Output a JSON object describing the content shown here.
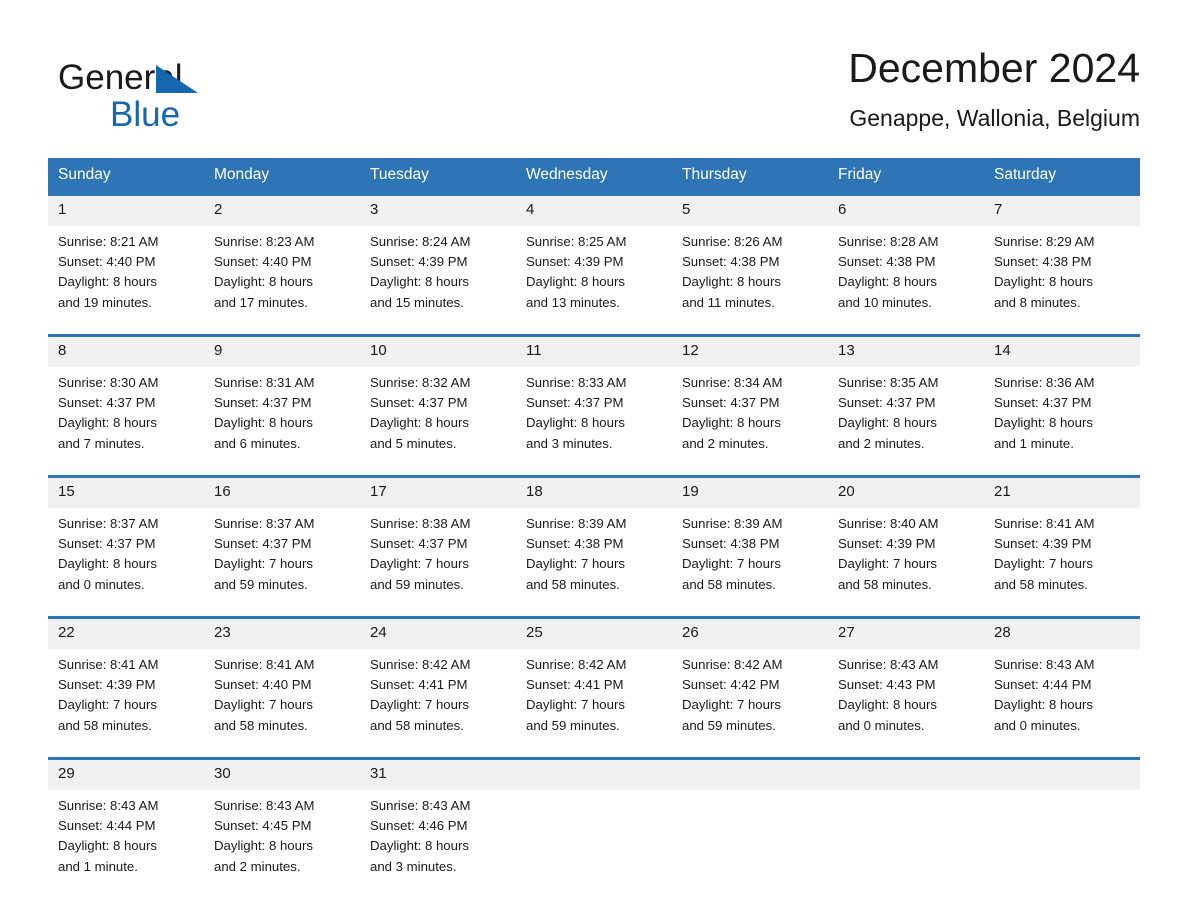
{
  "brand": {
    "name_top": "General",
    "name_bottom": "Blue",
    "accent_color": "#1666b0",
    "header_color": "#2e75b6"
  },
  "header": {
    "title": "December 2024",
    "subtitle": "Genappe, Wallonia, Belgium"
  },
  "weekday_headers": [
    "Sunday",
    "Monday",
    "Tuesday",
    "Wednesday",
    "Thursday",
    "Friday",
    "Saturday"
  ],
  "weeks": [
    [
      {
        "day": "1",
        "sunrise": "Sunrise: 8:21 AM",
        "sunset": "Sunset: 4:40 PM",
        "daylight_line1": "Daylight: 8 hours",
        "daylight_line2": "and 19 minutes."
      },
      {
        "day": "2",
        "sunrise": "Sunrise: 8:23 AM",
        "sunset": "Sunset: 4:40 PM",
        "daylight_line1": "Daylight: 8 hours",
        "daylight_line2": "and 17 minutes."
      },
      {
        "day": "3",
        "sunrise": "Sunrise: 8:24 AM",
        "sunset": "Sunset: 4:39 PM",
        "daylight_line1": "Daylight: 8 hours",
        "daylight_line2": "and 15 minutes."
      },
      {
        "day": "4",
        "sunrise": "Sunrise: 8:25 AM",
        "sunset": "Sunset: 4:39 PM",
        "daylight_line1": "Daylight: 8 hours",
        "daylight_line2": "and 13 minutes."
      },
      {
        "day": "5",
        "sunrise": "Sunrise: 8:26 AM",
        "sunset": "Sunset: 4:38 PM",
        "daylight_line1": "Daylight: 8 hours",
        "daylight_line2": "and 11 minutes."
      },
      {
        "day": "6",
        "sunrise": "Sunrise: 8:28 AM",
        "sunset": "Sunset: 4:38 PM",
        "daylight_line1": "Daylight: 8 hours",
        "daylight_line2": "and 10 minutes."
      },
      {
        "day": "7",
        "sunrise": "Sunrise: 8:29 AM",
        "sunset": "Sunset: 4:38 PM",
        "daylight_line1": "Daylight: 8 hours",
        "daylight_line2": "and 8 minutes."
      }
    ],
    [
      {
        "day": "8",
        "sunrise": "Sunrise: 8:30 AM",
        "sunset": "Sunset: 4:37 PM",
        "daylight_line1": "Daylight: 8 hours",
        "daylight_line2": "and 7 minutes."
      },
      {
        "day": "9",
        "sunrise": "Sunrise: 8:31 AM",
        "sunset": "Sunset: 4:37 PM",
        "daylight_line1": "Daylight: 8 hours",
        "daylight_line2": "and 6 minutes."
      },
      {
        "day": "10",
        "sunrise": "Sunrise: 8:32 AM",
        "sunset": "Sunset: 4:37 PM",
        "daylight_line1": "Daylight: 8 hours",
        "daylight_line2": "and 5 minutes."
      },
      {
        "day": "11",
        "sunrise": "Sunrise: 8:33 AM",
        "sunset": "Sunset: 4:37 PM",
        "daylight_line1": "Daylight: 8 hours",
        "daylight_line2": "and 3 minutes."
      },
      {
        "day": "12",
        "sunrise": "Sunrise: 8:34 AM",
        "sunset": "Sunset: 4:37 PM",
        "daylight_line1": "Daylight: 8 hours",
        "daylight_line2": "and 2 minutes."
      },
      {
        "day": "13",
        "sunrise": "Sunrise: 8:35 AM",
        "sunset": "Sunset: 4:37 PM",
        "daylight_line1": "Daylight: 8 hours",
        "daylight_line2": "and 2 minutes."
      },
      {
        "day": "14",
        "sunrise": "Sunrise: 8:36 AM",
        "sunset": "Sunset: 4:37 PM",
        "daylight_line1": "Daylight: 8 hours",
        "daylight_line2": "and 1 minute."
      }
    ],
    [
      {
        "day": "15",
        "sunrise": "Sunrise: 8:37 AM",
        "sunset": "Sunset: 4:37 PM",
        "daylight_line1": "Daylight: 8 hours",
        "daylight_line2": "and 0 minutes."
      },
      {
        "day": "16",
        "sunrise": "Sunrise: 8:37 AM",
        "sunset": "Sunset: 4:37 PM",
        "daylight_line1": "Daylight: 7 hours",
        "daylight_line2": "and 59 minutes."
      },
      {
        "day": "17",
        "sunrise": "Sunrise: 8:38 AM",
        "sunset": "Sunset: 4:37 PM",
        "daylight_line1": "Daylight: 7 hours",
        "daylight_line2": "and 59 minutes."
      },
      {
        "day": "18",
        "sunrise": "Sunrise: 8:39 AM",
        "sunset": "Sunset: 4:38 PM",
        "daylight_line1": "Daylight: 7 hours",
        "daylight_line2": "and 58 minutes."
      },
      {
        "day": "19",
        "sunrise": "Sunrise: 8:39 AM",
        "sunset": "Sunset: 4:38 PM",
        "daylight_line1": "Daylight: 7 hours",
        "daylight_line2": "and 58 minutes."
      },
      {
        "day": "20",
        "sunrise": "Sunrise: 8:40 AM",
        "sunset": "Sunset: 4:39 PM",
        "daylight_line1": "Daylight: 7 hours",
        "daylight_line2": "and 58 minutes."
      },
      {
        "day": "21",
        "sunrise": "Sunrise: 8:41 AM",
        "sunset": "Sunset: 4:39 PM",
        "daylight_line1": "Daylight: 7 hours",
        "daylight_line2": "and 58 minutes."
      }
    ],
    [
      {
        "day": "22",
        "sunrise": "Sunrise: 8:41 AM",
        "sunset": "Sunset: 4:39 PM",
        "daylight_line1": "Daylight: 7 hours",
        "daylight_line2": "and 58 minutes."
      },
      {
        "day": "23",
        "sunrise": "Sunrise: 8:41 AM",
        "sunset": "Sunset: 4:40 PM",
        "daylight_line1": "Daylight: 7 hours",
        "daylight_line2": "and 58 minutes."
      },
      {
        "day": "24",
        "sunrise": "Sunrise: 8:42 AM",
        "sunset": "Sunset: 4:41 PM",
        "daylight_line1": "Daylight: 7 hours",
        "daylight_line2": "and 58 minutes."
      },
      {
        "day": "25",
        "sunrise": "Sunrise: 8:42 AM",
        "sunset": "Sunset: 4:41 PM",
        "daylight_line1": "Daylight: 7 hours",
        "daylight_line2": "and 59 minutes."
      },
      {
        "day": "26",
        "sunrise": "Sunrise: 8:42 AM",
        "sunset": "Sunset: 4:42 PM",
        "daylight_line1": "Daylight: 7 hours",
        "daylight_line2": "and 59 minutes."
      },
      {
        "day": "27",
        "sunrise": "Sunrise: 8:43 AM",
        "sunset": "Sunset: 4:43 PM",
        "daylight_line1": "Daylight: 8 hours",
        "daylight_line2": "and 0 minutes."
      },
      {
        "day": "28",
        "sunrise": "Sunrise: 8:43 AM",
        "sunset": "Sunset: 4:44 PM",
        "daylight_line1": "Daylight: 8 hours",
        "daylight_line2": "and 0 minutes."
      }
    ],
    [
      {
        "day": "29",
        "sunrise": "Sunrise: 8:43 AM",
        "sunset": "Sunset: 4:44 PM",
        "daylight_line1": "Daylight: 8 hours",
        "daylight_line2": "and 1 minute."
      },
      {
        "day": "30",
        "sunrise": "Sunrise: 8:43 AM",
        "sunset": "Sunset: 4:45 PM",
        "daylight_line1": "Daylight: 8 hours",
        "daylight_line2": "and 2 minutes."
      },
      {
        "day": "31",
        "sunrise": "Sunrise: 8:43 AM",
        "sunset": "Sunset: 4:46 PM",
        "daylight_line1": "Daylight: 8 hours",
        "daylight_line2": "and 3 minutes."
      },
      {
        "day": "",
        "sunrise": "",
        "sunset": "",
        "daylight_line1": "",
        "daylight_line2": ""
      },
      {
        "day": "",
        "sunrise": "",
        "sunset": "",
        "daylight_line1": "",
        "daylight_line2": ""
      },
      {
        "day": "",
        "sunrise": "",
        "sunset": "",
        "daylight_line1": "",
        "daylight_line2": ""
      },
      {
        "day": "",
        "sunrise": "",
        "sunset": "",
        "daylight_line1": "",
        "daylight_line2": ""
      }
    ]
  ]
}
